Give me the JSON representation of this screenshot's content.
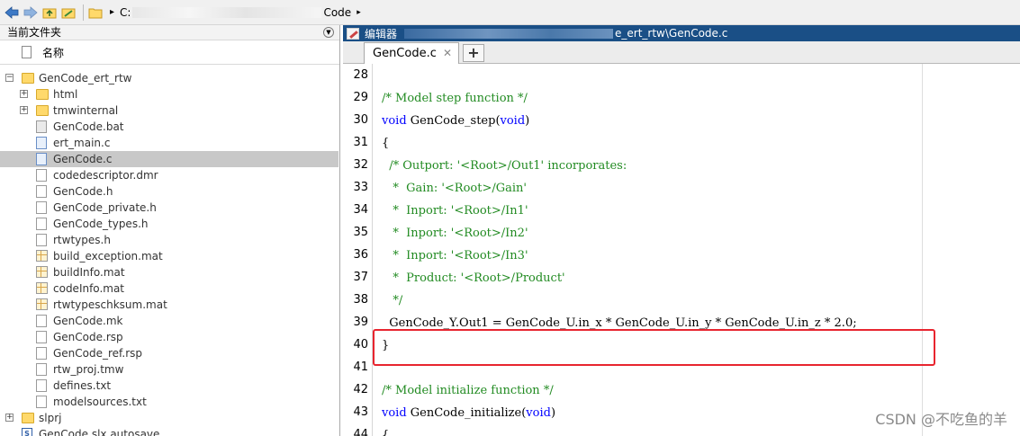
{
  "toolbar": {
    "breadcrumb_start": "C:",
    "breadcrumb_end": "Code",
    "arrow": "▸"
  },
  "left_panel": {
    "title": "当前文件夹",
    "collapse_icon": "⊝",
    "column_name": "名称",
    "items": [
      {
        "label": "GenCode_ert_rtw",
        "type": "folder",
        "level": 0,
        "expander": "⊟"
      },
      {
        "label": "html",
        "type": "folder",
        "level": 1,
        "expander": "⊞"
      },
      {
        "label": "tmwinternal",
        "type": "folder",
        "level": 1,
        "expander": "⊞"
      },
      {
        "label": "GenCode.bat",
        "type": "bat",
        "level": 1
      },
      {
        "label": "ert_main.c",
        "type": "cfile",
        "level": 1
      },
      {
        "label": "GenCode.c",
        "type": "cfile",
        "level": 1,
        "selected": true
      },
      {
        "label": "codedescriptor.dmr",
        "type": "doc",
        "level": 1
      },
      {
        "label": "GenCode.h",
        "type": "doc",
        "level": 1
      },
      {
        "label": "GenCode_private.h",
        "type": "doc",
        "level": 1
      },
      {
        "label": "GenCode_types.h",
        "type": "doc",
        "level": 1
      },
      {
        "label": "rtwtypes.h",
        "type": "doc",
        "level": 1
      },
      {
        "label": "build_exception.mat",
        "type": "mat",
        "level": 1
      },
      {
        "label": "buildInfo.mat",
        "type": "mat",
        "level": 1
      },
      {
        "label": "codeInfo.mat",
        "type": "mat",
        "level": 1
      },
      {
        "label": "rtwtypeschksum.mat",
        "type": "mat",
        "level": 1
      },
      {
        "label": "GenCode.mk",
        "type": "doc",
        "level": 1
      },
      {
        "label": "GenCode.rsp",
        "type": "doc",
        "level": 1
      },
      {
        "label": "GenCode_ref.rsp",
        "type": "doc",
        "level": 1
      },
      {
        "label": "rtw_proj.tmw",
        "type": "doc",
        "level": 1
      },
      {
        "label": "defines.txt",
        "type": "doc",
        "level": 1
      },
      {
        "label": "modelsources.txt",
        "type": "doc",
        "level": 1
      },
      {
        "label": "slprj",
        "type": "folder",
        "level": 0,
        "expander": "⊞"
      },
      {
        "label": "GenCode.slx.autosave",
        "type": "slx",
        "level": 0
      }
    ]
  },
  "editor": {
    "title_prefix": "编辑器",
    "title_suffix": "e_ert_rtw\\GenCode.c",
    "tab_label": "GenCode.c",
    "tab_close": "✕",
    "tab_add": "+",
    "lines": [
      {
        "n": "28",
        "parts": []
      },
      {
        "n": "29",
        "parts": [
          {
            "t": "/* Model step function */",
            "c": "cm"
          }
        ]
      },
      {
        "n": "30",
        "parts": [
          {
            "t": "void",
            "c": "kw"
          },
          {
            "t": " GenCode_step(",
            "c": ""
          },
          {
            "t": "void",
            "c": "kw"
          },
          {
            "t": ")",
            "c": ""
          }
        ]
      },
      {
        "n": "31",
        "parts": [
          {
            "t": "{",
            "c": ""
          }
        ]
      },
      {
        "n": "32",
        "parts": [
          {
            "t": "  /* Outport: '<Root>/Out1' incorporates:",
            "c": "cm"
          }
        ]
      },
      {
        "n": "33",
        "parts": [
          {
            "t": "   *  Gain: '<Root>/Gain'",
            "c": "cm"
          }
        ]
      },
      {
        "n": "34",
        "parts": [
          {
            "t": "   *  Inport: '<Root>/In1'",
            "c": "cm"
          }
        ]
      },
      {
        "n": "35",
        "parts": [
          {
            "t": "   *  Inport: '<Root>/In2'",
            "c": "cm"
          }
        ]
      },
      {
        "n": "36",
        "parts": [
          {
            "t": "   *  Inport: '<Root>/In3'",
            "c": "cm"
          }
        ]
      },
      {
        "n": "37",
        "parts": [
          {
            "t": "   *  Product: '<Root>/Product'",
            "c": "cm"
          }
        ]
      },
      {
        "n": "38",
        "parts": [
          {
            "t": "   */",
            "c": "cm"
          }
        ]
      },
      {
        "n": "39",
        "parts": [
          {
            "t": "  GenCode_Y.Out1 = GenCode_U.in_x * GenCode_U.in_y * GenCode_U.in_z * 2.0;",
            "c": ""
          }
        ]
      },
      {
        "n": "40",
        "parts": [
          {
            "t": "}",
            "c": ""
          }
        ]
      },
      {
        "n": "41",
        "parts": []
      },
      {
        "n": "42",
        "parts": [
          {
            "t": "/* Model initialize function */",
            "c": "cm"
          }
        ]
      },
      {
        "n": "43",
        "parts": [
          {
            "t": "void",
            "c": "kw"
          },
          {
            "t": " GenCode_initialize(",
            "c": ""
          },
          {
            "t": "void",
            "c": "kw"
          },
          {
            "t": ")",
            "c": ""
          }
        ]
      },
      {
        "n": "44",
        "parts": [
          {
            "t": "{",
            "c": ""
          }
        ]
      }
    ]
  },
  "watermark": "CSDN @不吃鱼的羊"
}
